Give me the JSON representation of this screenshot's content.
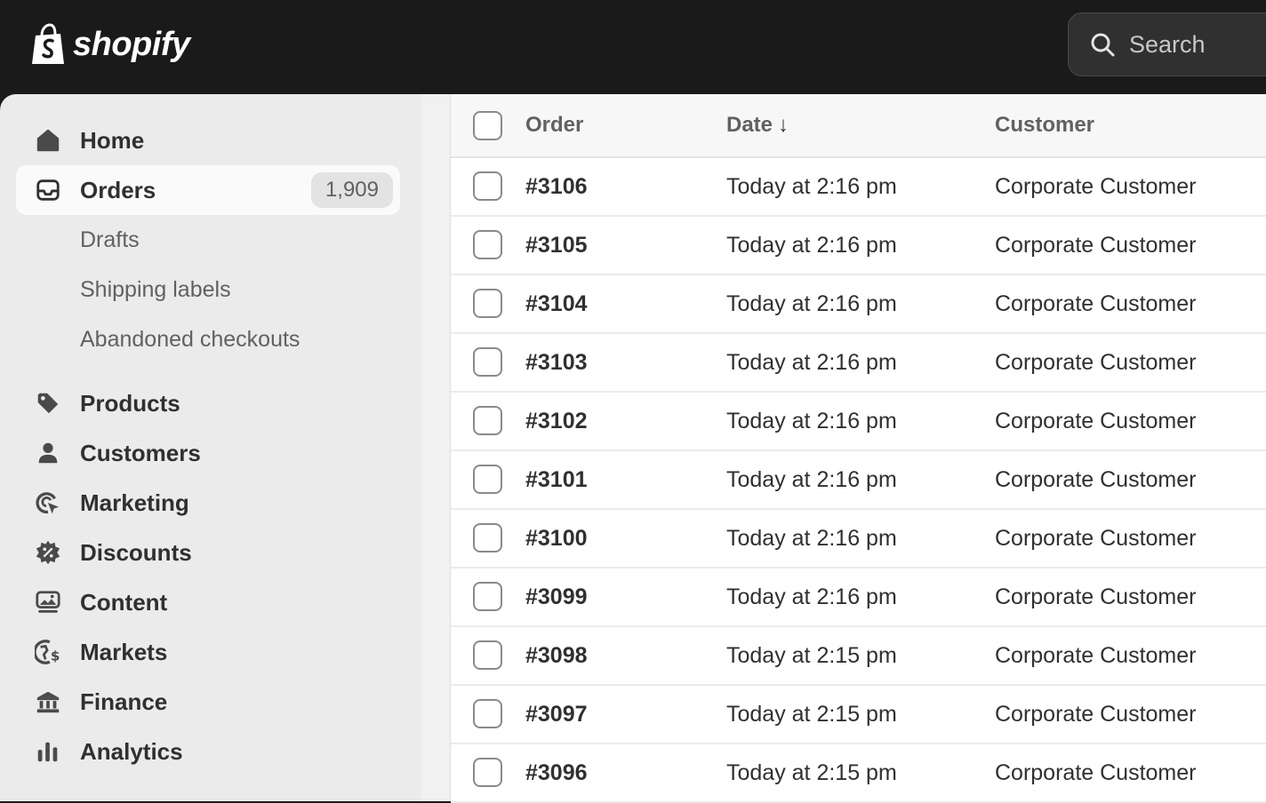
{
  "topbar": {
    "logo_text": "shopify",
    "search_placeholder": "Search"
  },
  "sidebar": {
    "home": "Home",
    "orders": "Orders",
    "orders_count": "1,909",
    "sub_items": [
      "Drafts",
      "Shipping labels",
      "Abandoned checkouts"
    ],
    "items": [
      "Products",
      "Customers",
      "Marketing",
      "Discounts",
      "Content",
      "Markets",
      "Finance",
      "Analytics"
    ]
  },
  "table": {
    "headers": {
      "order": "Order",
      "date": "Date",
      "customer": "Customer"
    },
    "sort_indicator": "↓",
    "rows": [
      {
        "order": "#3106",
        "date": "Today at 2:16 pm",
        "customer": "Corporate Customer"
      },
      {
        "order": "#3105",
        "date": "Today at 2:16 pm",
        "customer": "Corporate Customer"
      },
      {
        "order": "#3104",
        "date": "Today at 2:16 pm",
        "customer": "Corporate Customer"
      },
      {
        "order": "#3103",
        "date": "Today at 2:16 pm",
        "customer": "Corporate Customer"
      },
      {
        "order": "#3102",
        "date": "Today at 2:16 pm",
        "customer": "Corporate Customer"
      },
      {
        "order": "#3101",
        "date": "Today at 2:16 pm",
        "customer": "Corporate Customer"
      },
      {
        "order": "#3100",
        "date": "Today at 2:16 pm",
        "customer": "Corporate Customer"
      },
      {
        "order": "#3099",
        "date": "Today at 2:16 pm",
        "customer": "Corporate Customer"
      },
      {
        "order": "#3098",
        "date": "Today at 2:15 pm",
        "customer": "Corporate Customer"
      },
      {
        "order": "#3097",
        "date": "Today at 2:15 pm",
        "customer": "Corporate Customer"
      },
      {
        "order": "#3096",
        "date": "Today at 2:15 pm",
        "customer": "Corporate Customer"
      }
    ]
  },
  "colors": {
    "topbar": "#1a1a1a",
    "sidebar": "#ebebeb",
    "text": "#303030",
    "muted": "#616161"
  }
}
